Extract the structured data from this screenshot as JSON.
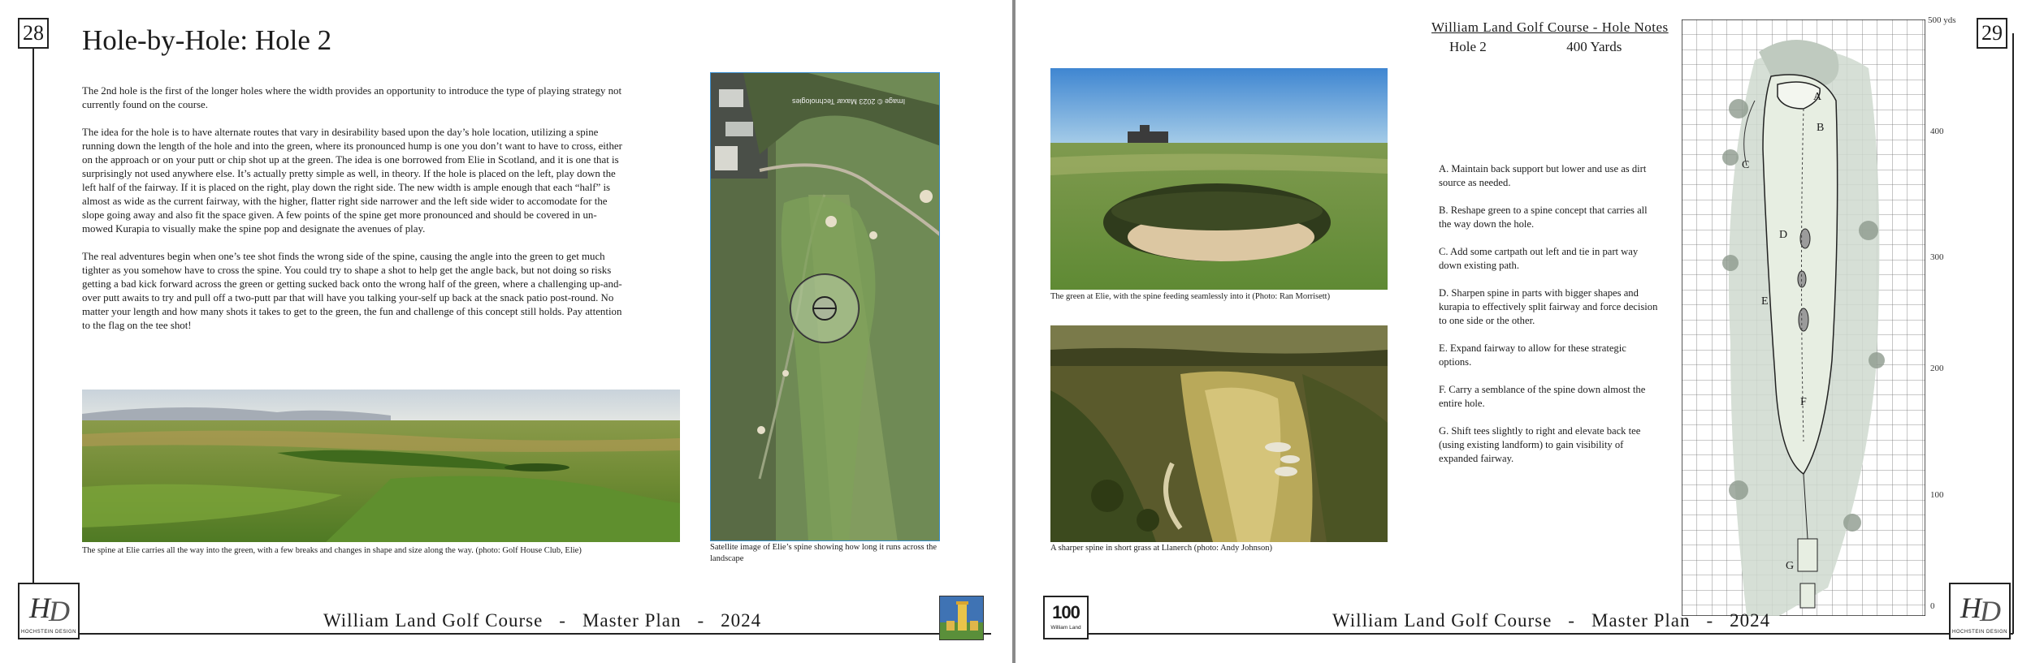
{
  "left_page": {
    "page_number": "28",
    "title": "Hole-by-Hole: Hole 2",
    "paragraphs": [
      "The 2nd hole is the first of the longer holes where the width provides an opportunity to introduce the type of playing strategy not currently found on the course.",
      "The idea for the hole is to have alternate routes that vary in desirability based upon the day’s hole location, utilizing a spine running down the length of the hole and into the green, where its pronounced hump is one you don’t want to have to cross, either on the approach or on your putt or chip shot up at the green.  The idea is one borrowed from Elie in Scotland, and it is one that is surprisingly not used anywhere else.  It’s actually pretty simple as well, in theory.  If the hole is placed on the left, play down the left half of the fairway.  If it is placed on the right, play down the right side.  The new width is ample enough that each “half” is almost as wide as the current fairway, with the higher, flatter right side narrower and the left side wider to accomodate for the slope going away and also fit the space given.  A few points of the spine get more pronounced and should be covered in un-mowed Kurapia to visually make the spine pop and designate the avenues of play.",
      "The real adventures begin when one’s tee shot finds the wrong side of the spine, causing the angle into the green to get much tighter as you somehow have to cross the spine.  You could try to shape a shot to help get the angle back, but not doing so risks getting a bad kick forward across the green or getting sucked back onto the wrong half of the green, where a challenging up-and-over putt awaits to try and pull off a two-putt par that will have you talking your-self up back at the snack patio post-round.  No matter your length and how many shots it takes to get to the green, the fun and challenge of this concept still holds.  Pay attention to the flag on the tee shot!"
    ],
    "photo_caption": "The spine at Elie carries all the way into the green, with a few breaks and changes in shape and size along the way. (photo: Golf House Club, Elie)",
    "satellite_caption": "Satellite image of Elie’s spine showing how long it runs across the landscape",
    "satellite_credit": "Image © 2023 Maxar Technologies",
    "logo_text": "HOCHSTEIN DESIGN"
  },
  "right_page": {
    "page_number": "29",
    "photo1_caption": "The green at Elie, with the spine feeding seamlessly into it (Photo: Ran Morrisett)",
    "photo2_caption": "A sharper spine in short grass at Llanerch (photo: Andy Johnson)",
    "notes_title": "William Land Golf Course - Hole Notes",
    "hole_label": "Hole 2",
    "yardage": "400 Yards",
    "notes": [
      "A. Maintain back support but lower and use as dirt source as needed.",
      "B. Reshape green to a spine concept that carries all the way down the hole.",
      "C. Add some cartpath out left and tie in part way down existing path.",
      "D.  Sharpen spine in parts with bigger shapes and kurapia to effectively split fairway and force decision to one side or the other.",
      "E. Expand fairway to allow for these strategic options.",
      "F. Carry a semblance of the spine down almost the entire hole.",
      "G. Shift tees slightly to right and elevate back tee (using existing landform) to gain visibility of expanded fairway."
    ],
    "plan_markers": [
      "A",
      "B",
      "C",
      "D",
      "E",
      "F",
      "G"
    ],
    "yard_axis": [
      "500 yds",
      "400",
      "300",
      "200",
      "100",
      "0"
    ],
    "centennial_logo": {
      "number": "100",
      "text": "William Land"
    },
    "logo_text": "HOCHSTEIN DESIGN"
  },
  "footer": {
    "course": "William Land Golf Course",
    "sep": "-",
    "plan": "Master Plan",
    "year": "2024"
  }
}
